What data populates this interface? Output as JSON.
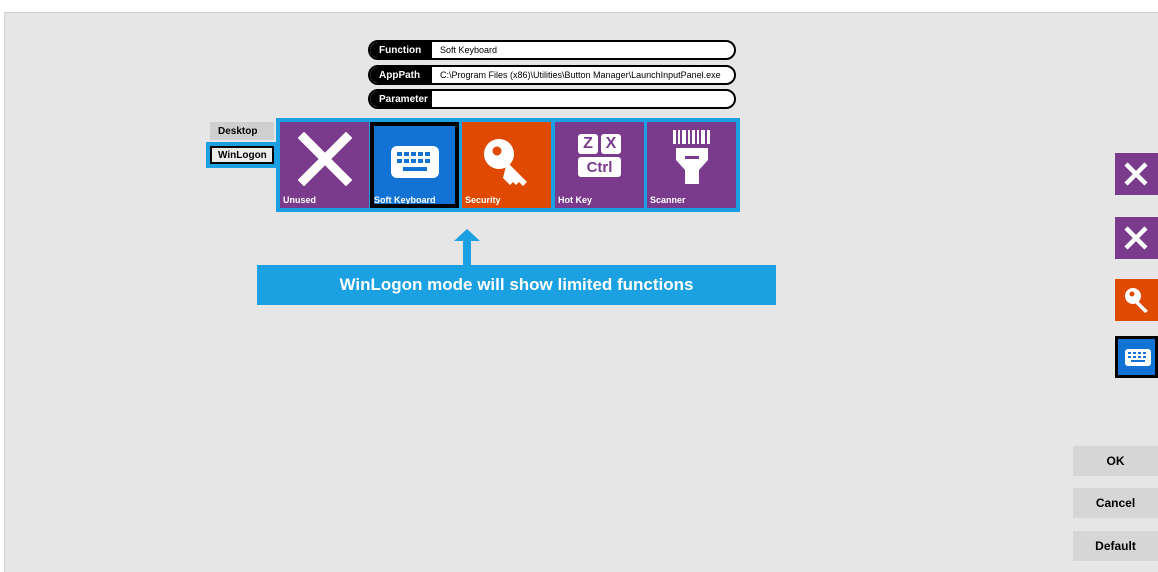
{
  "fields": {
    "function": {
      "label": "Function",
      "value": "Soft Keyboard"
    },
    "apppath": {
      "label": "AppPath",
      "value": "C:\\Program Files (x86)\\Utilities\\Button Manager\\LaunchInputPanel.exe"
    },
    "parameter": {
      "label": "Parameter",
      "value": ""
    }
  },
  "modes": {
    "desktop": "Desktop",
    "winlogon": "WinLogon",
    "selected": "WinLogon"
  },
  "tiles": [
    {
      "label": "Unused",
      "icon": "x-icon",
      "color": "#7a3b8c"
    },
    {
      "label": "Soft Keyboard",
      "icon": "keyboard-icon",
      "color": "#1273d4",
      "selected": true
    },
    {
      "label": "Security",
      "icon": "key-icon",
      "color": "#e04a00"
    },
    {
      "label": "Hot Key",
      "icon": "hotkey-icon",
      "color": "#7a3b8c"
    },
    {
      "label": "Scanner",
      "icon": "barcode-scanner-icon",
      "color": "#7a3b8c"
    }
  ],
  "hotkey_keys": {
    "k1": "Z",
    "k2": "X",
    "k3": "Ctrl"
  },
  "banner": "WinLogon mode will show limited functions",
  "side_buttons": [
    {
      "icon": "x-icon",
      "color": "#7a3b8c"
    },
    {
      "icon": "x-icon",
      "color": "#7a3b8c"
    },
    {
      "icon": "key-icon",
      "color": "#e04a00"
    },
    {
      "icon": "keyboard-icon",
      "color": "#1273d4",
      "selected": true
    }
  ],
  "buttons": {
    "ok": "OK",
    "cancel": "Cancel",
    "default": "Default"
  },
  "colors": {
    "accent": "#1ba1e2",
    "background": "#e6e6e6"
  }
}
